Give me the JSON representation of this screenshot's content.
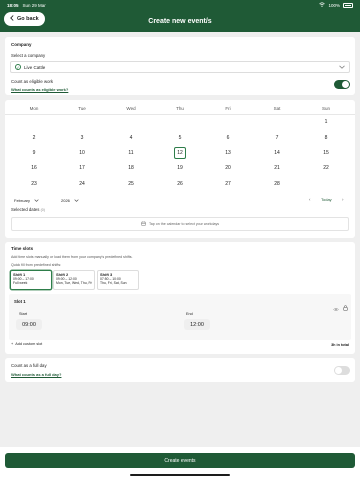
{
  "status_bar": {
    "time": "18:05",
    "date": "Sun 29 Mar",
    "battery": "100%"
  },
  "header": {
    "back_label": "Go back",
    "title": "Create new event/s"
  },
  "company": {
    "section_title": "Company",
    "select_label": "Select a company",
    "selected": "Live Cattle",
    "eligible_label": "Count as eligible work",
    "eligible_link": "What counts as eligible work?",
    "eligible_on": true
  },
  "calendar": {
    "weekdays": [
      "Mon",
      "Tue",
      "Wed",
      "Thu",
      "Fri",
      "Sat",
      "Sun"
    ],
    "weeks": [
      [
        "",
        "",
        "",
        "",
        "",
        "",
        "1"
      ],
      [
        "2",
        "3",
        "4",
        "5",
        "6",
        "7",
        "8"
      ],
      [
        "9",
        "10",
        "11",
        "12",
        "13",
        "14",
        "15"
      ],
      [
        "16",
        "17",
        "18",
        "19",
        "20",
        "21",
        "22"
      ],
      [
        "23",
        "24",
        "25",
        "26",
        "27",
        "28",
        ""
      ]
    ],
    "today": "12",
    "month": "February",
    "year": "2026",
    "today_label": "Today",
    "selected_dates_label": "Selected dates",
    "selected_count": "(0)",
    "hint": "Tap on the calendar to select your workdays"
  },
  "time_slots": {
    "title": "Time slots",
    "description": "Add time slots manually or load them from your company's predefined shifts.",
    "quick_fill": "Quick fill from predefined shifts:",
    "shifts": [
      {
        "name": "Shift 1",
        "time": "09:00 – 17:00",
        "days": "Full week"
      },
      {
        "name": "Shift 2",
        "time": "09:00 – 12:00",
        "days": "Mon, Tue, Wed, Thu, Fri"
      },
      {
        "name": "Shift 3",
        "time": "07:50 – 10:00",
        "days": "Thu, Fri, Sat, Sun"
      }
    ],
    "slot": {
      "name": "Slot 1",
      "start_label": "Start",
      "start": "09:00",
      "end_label": "End",
      "end": "12:00"
    },
    "add_label": "Add custom slot",
    "total": "3h in total"
  },
  "full_day": {
    "label": "Count as a full day",
    "link": "What counts as a full day?",
    "on": false
  },
  "footer": {
    "create_label": "Create events"
  },
  "colors": {
    "brand": "#1f5a36",
    "accent": "#2e7d4a"
  }
}
